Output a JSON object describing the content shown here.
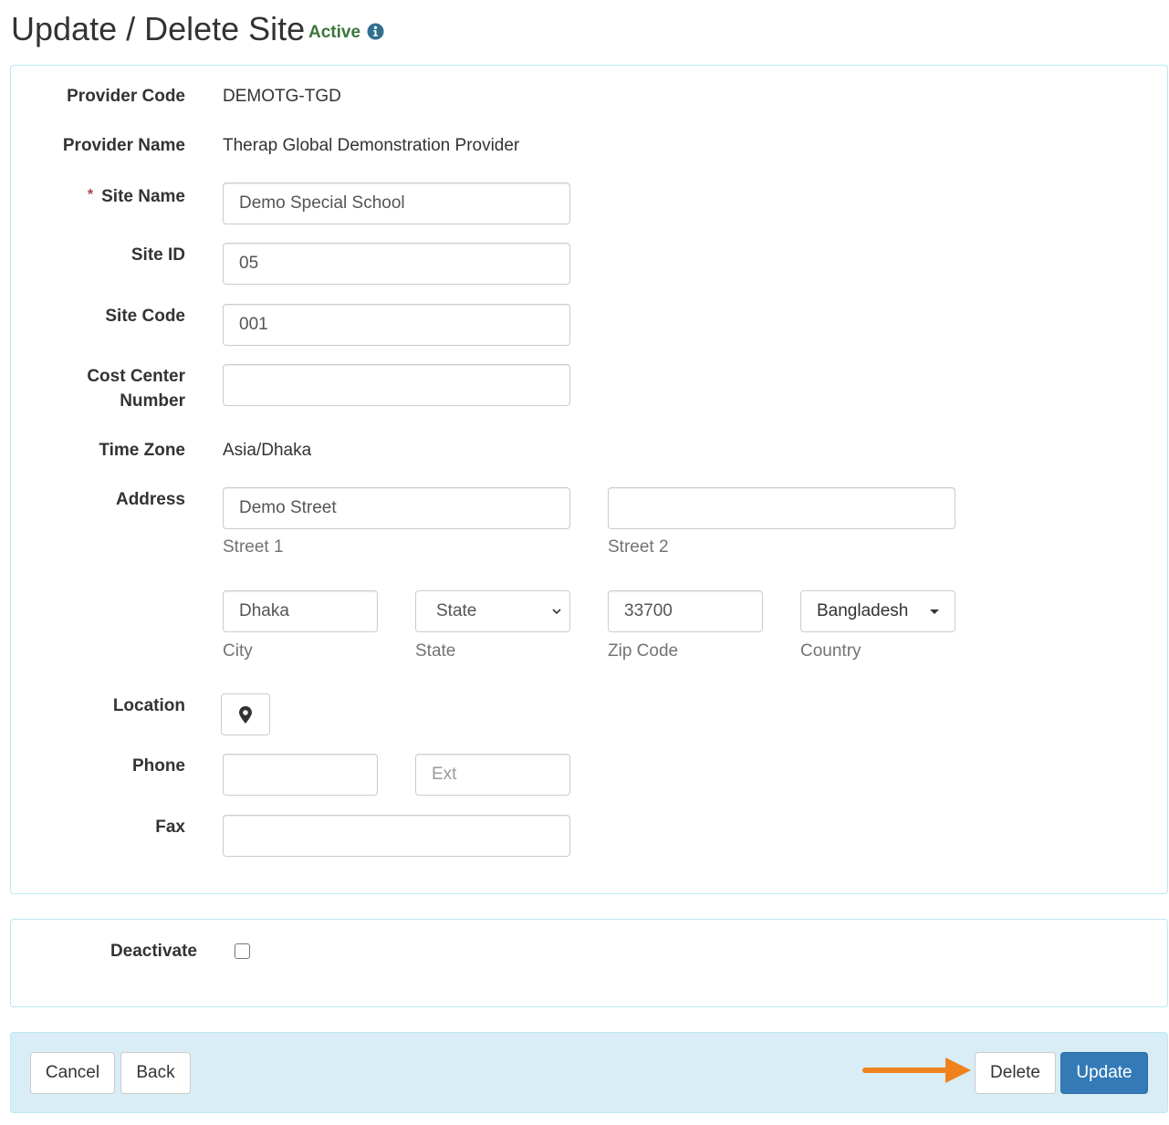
{
  "header": {
    "title": "Update / Delete Site",
    "status": "Active",
    "status_color": "#3c763d",
    "info_icon": "info-circle-icon"
  },
  "form": {
    "provider_code": {
      "label": "Provider Code",
      "value": "DEMOTG-TGD"
    },
    "provider_name": {
      "label": "Provider Name",
      "value": "Therap Global Demonstration Provider"
    },
    "site_name": {
      "label": "Site Name",
      "required_marker": "*",
      "value": "Demo Special School"
    },
    "site_id": {
      "label": "Site ID",
      "value": "05"
    },
    "site_code": {
      "label": "Site Code",
      "value": "001"
    },
    "cost_center": {
      "label": "Cost Center Number",
      "value": ""
    },
    "time_zone": {
      "label": "Time Zone",
      "value": "Asia/Dhaka"
    },
    "address": {
      "label": "Address",
      "street1": {
        "value": "Demo Street",
        "help": "Street 1"
      },
      "street2": {
        "value": "",
        "help": "Street 2"
      },
      "city": {
        "value": "Dhaka",
        "help": "City"
      },
      "state": {
        "selected": "State",
        "help": "State"
      },
      "zip": {
        "value": "33700",
        "help": "Zip Code"
      },
      "country": {
        "selected": "Bangladesh",
        "help": "Country"
      }
    },
    "location": {
      "label": "Location",
      "icon": "map-marker-icon"
    },
    "phone": {
      "label": "Phone",
      "value": "",
      "ext_placeholder": "Ext",
      "ext_value": ""
    },
    "fax": {
      "label": "Fax",
      "value": ""
    }
  },
  "deactivate": {
    "label": "Deactivate",
    "checked": false
  },
  "footer": {
    "cancel_label": "Cancel",
    "back_label": "Back",
    "delete_label": "Delete",
    "update_label": "Update",
    "annotation_arrow_color": "#f0821e",
    "primary_color": "#337ab7"
  }
}
